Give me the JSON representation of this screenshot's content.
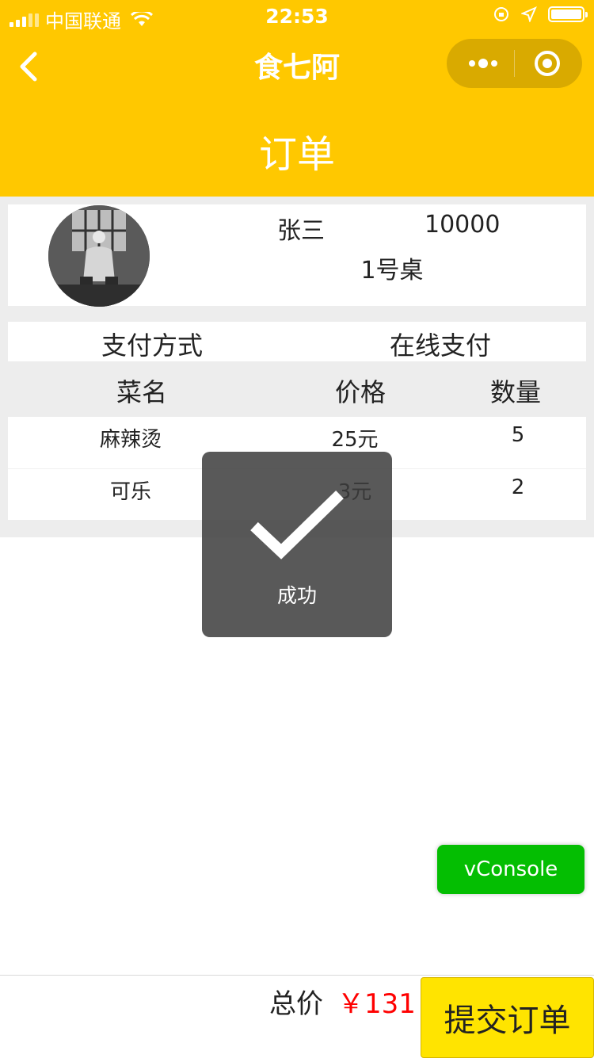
{
  "status_bar": {
    "carrier": "中国联通",
    "time": "22:53",
    "signal_bars": 3,
    "battery_level": 1.0
  },
  "nav": {
    "title": "食七阿",
    "back_icon": "chevron-left-icon",
    "menu_icon": "more-dots-icon",
    "home_icon": "circle-target-icon"
  },
  "page": {
    "title": "订单"
  },
  "user": {
    "name": "张三",
    "id": "10000",
    "table": "1号桌",
    "avatar_icon": "avatar-photo"
  },
  "payment": {
    "label": "支付方式",
    "value": "在线支付"
  },
  "columns": [
    "菜名",
    "价格",
    "数量"
  ],
  "items": [
    {
      "name": "麻辣烫",
      "price": "25元",
      "qty": "5"
    },
    {
      "name": "可乐",
      "price": "3元",
      "qty": "2"
    }
  ],
  "toast": {
    "message": "成功",
    "icon": "checkmark-icon"
  },
  "vconsole": {
    "label": "vConsole"
  },
  "footer": {
    "total_label": "总价",
    "total_value": "￥131",
    "submit_label": "提交订单"
  },
  "colors": {
    "header": "#FFC800",
    "submit": "#FFE400",
    "price": "#FF0000",
    "vconsole": "#04BE02"
  }
}
